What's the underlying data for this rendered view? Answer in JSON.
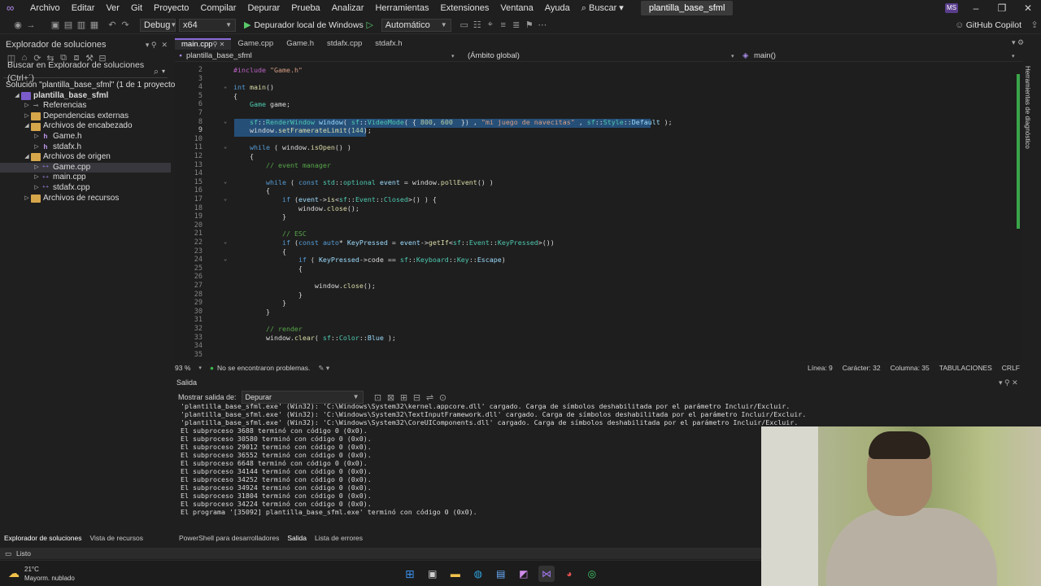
{
  "menubar": {
    "items": [
      "Archivo",
      "Editar",
      "Ver",
      "Git",
      "Proyecto",
      "Compilar",
      "Depurar",
      "Prueba",
      "Analizar",
      "Herramientas",
      "Extensiones",
      "Ventana",
      "Ayuda"
    ],
    "search_label": "Buscar",
    "solution_name": "plantilla_base_sfml",
    "user_initials": "MS"
  },
  "toolbar": {
    "config": "Debug",
    "platform": "x64",
    "run_label": "Depurador local de Windows",
    "mode": "Automático",
    "copilot_label": "GitHub Copilot"
  },
  "solution_explorer": {
    "title": "Explorador de soluciones",
    "search_placeholder": "Buscar en Explorador de soluciones (Ctrl+´)",
    "tree": [
      {
        "label": "Solución \"plantilla_base_sfml\" (1 de 1 proyecto)",
        "level": 0,
        "kind": "solution"
      },
      {
        "label": "plantilla_base_sfml",
        "level": 1,
        "kind": "project"
      },
      {
        "label": "Referencias",
        "level": 2,
        "kind": "refs"
      },
      {
        "label": "Dependencias externas",
        "level": 2,
        "kind": "folder"
      },
      {
        "label": "Archivos de encabezado",
        "level": 2,
        "kind": "folder"
      },
      {
        "label": "Game.h",
        "level": 3,
        "kind": "h"
      },
      {
        "label": "stdafx.h",
        "level": 3,
        "kind": "h"
      },
      {
        "label": "Archivos de origen",
        "level": 2,
        "kind": "folder"
      },
      {
        "label": "Game.cpp",
        "level": 3,
        "kind": "cpp",
        "selected": true
      },
      {
        "label": "main.cpp",
        "level": 3,
        "kind": "cpp"
      },
      {
        "label": "stdafx.cpp",
        "level": 3,
        "kind": "cpp"
      },
      {
        "label": "Archivos de recursos",
        "level": 2,
        "kind": "folder"
      }
    ]
  },
  "tabs": [
    {
      "label": "main.cpp",
      "active": true
    },
    {
      "label": "Game.cpp"
    },
    {
      "label": "Game.h"
    },
    {
      "label": "stdafx.cpp"
    },
    {
      "label": "stdafx.h"
    }
  ],
  "navbar": {
    "project": "plantilla_base_sfml",
    "scope": "(Ámbito global)",
    "member": "main()"
  },
  "editor_status": {
    "zoom": "93 %",
    "problems": "No se encontraron problemas.",
    "line": "Línea: 9",
    "char": "Carácter: 32",
    "col": "Columna: 35",
    "tabs": "TABULACIONES",
    "eol": "CRLF"
  },
  "output": {
    "title": "Salida",
    "show_from_label": "Mostrar salida de:",
    "source": "Depurar",
    "lines": [
      "'plantilla_base_sfml.exe' (Win32): 'C:\\Windows\\System32\\kernel.appcore.dll' cargado. Carga de símbolos deshabilitada por el parámetro Incluir/Excluir.",
      "'plantilla_base_sfml.exe' (Win32): 'C:\\Windows\\System32\\TextInputFramework.dll' cargado. Carga de símbolos deshabilitada por el parámetro Incluir/Excluir.",
      "'plantilla_base_sfml.exe' (Win32): 'C:\\Windows\\System32\\CoreUIComponents.dll' cargado. Carga de símbolos deshabilitada por el parámetro Incluir/Excluir.",
      "El subproceso 3688 terminó con código 0 (0x0).",
      "El subproceso 30580 terminó con código 0 (0x0).",
      "El subproceso 29012 terminó con código 0 (0x0).",
      "El subproceso 36552 terminó con código 0 (0x0).",
      "El subproceso 6648 terminó con código 0 (0x0).",
      "El subproceso 34144 terminó con código 0 (0x0).",
      "El subproceso 34252 terminó con código 0 (0x0).",
      "El subproceso 34924 terminó con código 0 (0x0).",
      "El subproceso 31804 terminó con código 0 (0x0).",
      "El subproceso 34224 terminó con código 0 (0x0).",
      "El programa '[35092] plantilla_base_sfml.exe' terminó con código 0 (0x0)."
    ]
  },
  "bottom_tabs_left": [
    "Explorador de soluciones",
    "Vista de recursos"
  ],
  "bottom_tabs_right": [
    "PowerShell para desarrolladores",
    "Salida",
    "Lista de errores"
  ],
  "statusbar": {
    "text": "Listo"
  },
  "weather": {
    "temp": "21°C",
    "desc": "Mayorm. nublado"
  },
  "side_panel": "Herramientas de diagnóstico",
  "colors": {
    "accent": "#8a6ad8",
    "selection": "#264f78",
    "editor_bg": "#1e1e1e"
  }
}
